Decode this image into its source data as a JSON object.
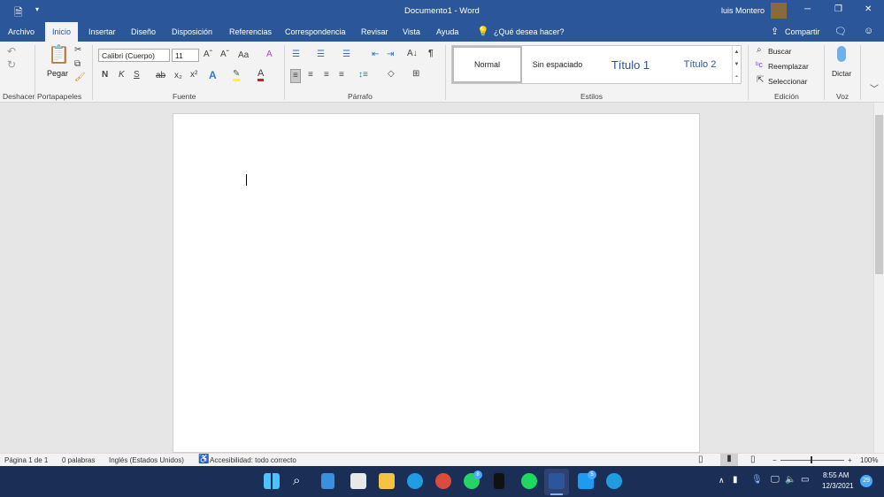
{
  "title": {
    "doc": "Documento1  -  Word",
    "user": "luis Montero",
    "minimize": "─",
    "restore": "❐",
    "close": "✕"
  },
  "tabs": [
    {
      "label": "Archivo"
    },
    {
      "label": "Inicio"
    },
    {
      "label": "Insertar"
    },
    {
      "label": "Diseño"
    },
    {
      "label": "Disposición"
    },
    {
      "label": "Referencias"
    },
    {
      "label": "Correspondencia"
    },
    {
      "label": "Revisar"
    },
    {
      "label": "Vista"
    },
    {
      "label": "Ayuda"
    }
  ],
  "tell_me": "¿Qué desea hacer?",
  "share": "Compartir",
  "ribbon": {
    "groups": {
      "undo": "Deshacer",
      "clipboard": "Portapapeles",
      "font": "Fuente",
      "paragraph": "Párrafo",
      "styles": "Estilos",
      "editing": "Edición",
      "voice": "Voz"
    },
    "paste": "Pegar",
    "font_name": "Calibri (Cuerpo)",
    "font_size": "11",
    "bold": "N",
    "italic": "K",
    "underline": "S",
    "strike": "ab",
    "sub": "x₂",
    "sup": "x²",
    "case": "Aa",
    "styles": [
      "Normal",
      "Sin espaciado",
      "Título 1",
      "Título 2"
    ],
    "find": "Buscar",
    "replace": "Reemplazar",
    "select": "Seleccionar",
    "dictate": "Dictar"
  },
  "status": {
    "page": "Página 1 de 1",
    "words": "0 palabras",
    "lang": "Inglés (Estados Unidos)",
    "accessibility": "Accesibilidad: todo correcto",
    "zoom": "100%",
    "zoom_level": 100
  },
  "taskbar": {
    "time": "8:55 AM",
    "date": "12/3/2021",
    "notifications": "29",
    "whatsapp_badge": "8",
    "twitter_badge": "5"
  },
  "colors": {
    "word_blue": "#2b579a",
    "taskbar": "#1a2e56",
    "highlight": "#ffff00",
    "font_color": "#e81123"
  }
}
